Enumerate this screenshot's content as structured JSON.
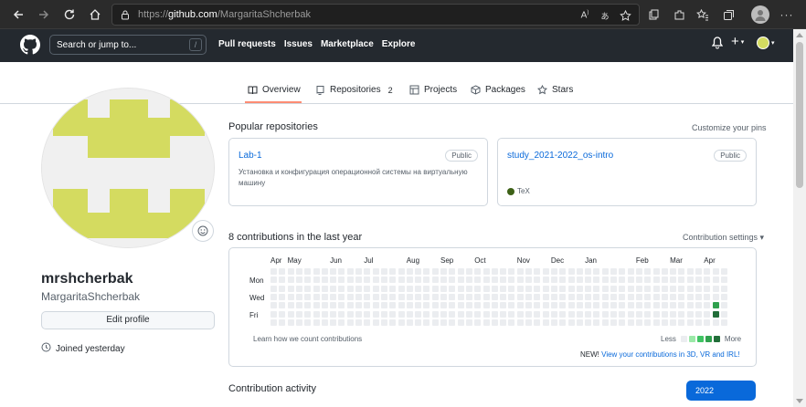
{
  "browser": {
    "url_prefix": "https://",
    "url_host": "github.com",
    "url_path": "/MargaritaShcherbak"
  },
  "header": {
    "search_placeholder": "Search or jump to...",
    "search_shortcut": "/",
    "nav": [
      "Pull requests",
      "Issues",
      "Marketplace",
      "Explore"
    ]
  },
  "tabs": [
    {
      "label": "Overview",
      "icon": "book-icon",
      "active": true
    },
    {
      "label": "Repositories",
      "icon": "repo-icon",
      "count": "2"
    },
    {
      "label": "Projects",
      "icon": "table-icon"
    },
    {
      "label": "Packages",
      "icon": "package-icon"
    },
    {
      "label": "Stars",
      "icon": "star-icon"
    }
  ],
  "profile": {
    "name": "mrshcherbak",
    "login": "MargaritaShcherbak",
    "edit_label": "Edit profile",
    "joined": "Joined yesterday"
  },
  "popular": {
    "title": "Popular repositories",
    "customize": "Customize your pins",
    "repos": [
      {
        "name": "Lab-1",
        "badge": "Public",
        "desc": "Установка и конфигурация операционной системы на виртуальную машину",
        "lang": ""
      },
      {
        "name": "study_2021-2022_os-intro",
        "badge": "Public",
        "desc": "",
        "lang": "TeX"
      }
    ]
  },
  "contributions": {
    "title": "8 contributions in the last year",
    "settings": "Contribution settings",
    "months": [
      "Apr",
      "May",
      "Jun",
      "Jul",
      "Aug",
      "Sep",
      "Oct",
      "Nov",
      "Dec",
      "Jan",
      "Feb",
      "Mar",
      "Apr"
    ],
    "days": [
      "Mon",
      "Wed",
      "Fri"
    ],
    "learn": "Learn how we count contributions",
    "less": "Less",
    "more": "More",
    "new_prefix": "NEW!",
    "new_link": "View your contributions in 3D, VR and IRL!",
    "active_cells": [
      {
        "week": 52,
        "day": 4,
        "level": 3
      },
      {
        "week": 52,
        "day": 5,
        "level": 4
      }
    ],
    "colors": [
      "#ebedf0",
      "#9be9a8",
      "#40c463",
      "#30a14e",
      "#216e39"
    ]
  },
  "activity": {
    "title": "Contribution activity",
    "year": "2022"
  }
}
